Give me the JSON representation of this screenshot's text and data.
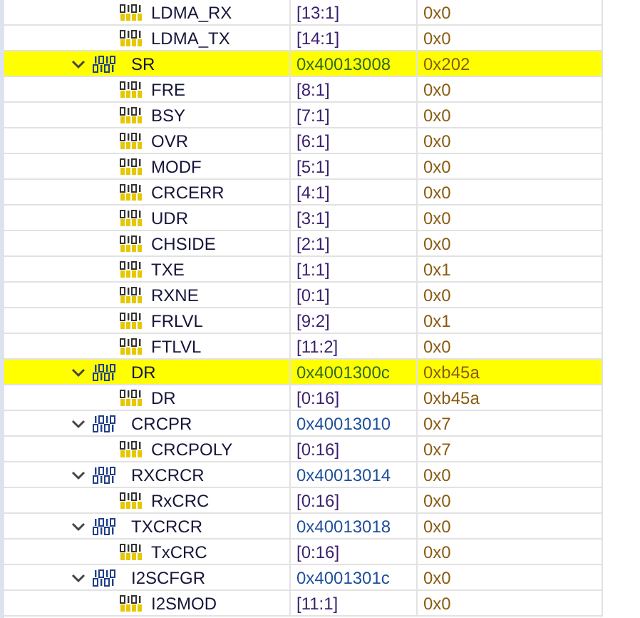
{
  "rows": [
    {
      "kind": "field",
      "name": "LDMA_RX",
      "range": "[13:1]",
      "value": "0x0"
    },
    {
      "kind": "field",
      "name": "LDMA_TX",
      "range": "[14:1]",
      "value": "0x0"
    },
    {
      "kind": "register",
      "name": "SR",
      "address": "0x40013008",
      "value": "0x202",
      "expanded": true,
      "highlighted": true,
      "children": [
        {
          "kind": "field",
          "name": "FRE",
          "range": "[8:1]",
          "value": "0x0"
        },
        {
          "kind": "field",
          "name": "BSY",
          "range": "[7:1]",
          "value": "0x0"
        },
        {
          "kind": "field",
          "name": "OVR",
          "range": "[6:1]",
          "value": "0x0"
        },
        {
          "kind": "field",
          "name": "MODF",
          "range": "[5:1]",
          "value": "0x0"
        },
        {
          "kind": "field",
          "name": "CRCERR",
          "range": "[4:1]",
          "value": "0x0"
        },
        {
          "kind": "field",
          "name": "UDR",
          "range": "[3:1]",
          "value": "0x0"
        },
        {
          "kind": "field",
          "name": "CHSIDE",
          "range": "[2:1]",
          "value": "0x0"
        },
        {
          "kind": "field",
          "name": "TXE",
          "range": "[1:1]",
          "value": "0x1"
        },
        {
          "kind": "field",
          "name": "RXNE",
          "range": "[0:1]",
          "value": "0x0"
        },
        {
          "kind": "field",
          "name": "FRLVL",
          "range": "[9:2]",
          "value": "0x1"
        },
        {
          "kind": "field",
          "name": "FTLVL",
          "range": "[11:2]",
          "value": "0x0"
        }
      ]
    },
    {
      "kind": "register",
      "name": "DR",
      "address": "0x4001300c",
      "value": "0xb45a",
      "expanded": true,
      "highlighted": true,
      "children": [
        {
          "kind": "field",
          "name": "DR",
          "range": "[0:16]",
          "value": "0xb45a"
        }
      ]
    },
    {
      "kind": "register",
      "name": "CRCPR",
      "address": "0x40013010",
      "value": "0x7",
      "expanded": true,
      "highlighted": false,
      "children": [
        {
          "kind": "field",
          "name": "CRCPOLY",
          "range": "[0:16]",
          "value": "0x7"
        }
      ]
    },
    {
      "kind": "register",
      "name": "RXCRCR",
      "address": "0x40013014",
      "value": "0x0",
      "expanded": true,
      "highlighted": false,
      "children": [
        {
          "kind": "field",
          "name": "RxCRC",
          "range": "[0:16]",
          "value": "0x0"
        }
      ]
    },
    {
      "kind": "register",
      "name": "TXCRCR",
      "address": "0x40013018",
      "value": "0x0",
      "expanded": true,
      "highlighted": false,
      "children": [
        {
          "kind": "field",
          "name": "TxCRC",
          "range": "[0:16]",
          "value": "0x0"
        }
      ]
    },
    {
      "kind": "register",
      "name": "I2SCFGR",
      "address": "0x4001301c",
      "value": "0x0",
      "expanded": true,
      "highlighted": false,
      "children": [
        {
          "kind": "field",
          "name": "I2SMOD",
          "range": "[11:1]",
          "value": "0x0"
        }
      ]
    }
  ]
}
